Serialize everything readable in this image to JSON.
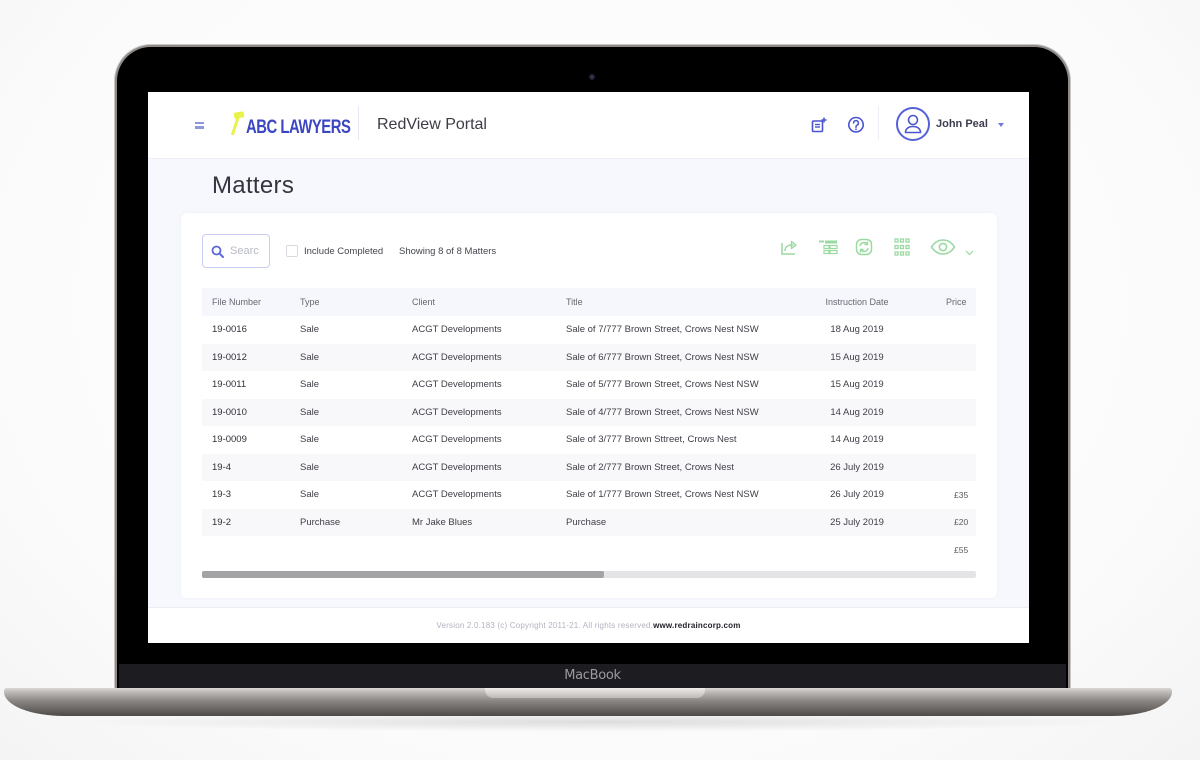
{
  "device": {
    "brand_label": "MacBook"
  },
  "header": {
    "menu_icon": "hamburger-icon",
    "logo_text": "ABC LAWYERS",
    "logo_icon": "gavel-icon",
    "portal_title": "RedView Portal",
    "icons": [
      "new-note-icon",
      "help-icon"
    ],
    "user": {
      "name": "John Peal",
      "avatar_icon": "user-avatar-icon",
      "caret_icon": "caret-down-icon"
    },
    "accent_color": "#4a55d0"
  },
  "page": {
    "title": "Matters"
  },
  "toolbar": {
    "search_placeholder": "Searc",
    "include_completed_label": "Include Completed",
    "include_completed_checked": false,
    "showing_text": "Showing 8 of 8 Matters",
    "tools": [
      "export-share-icon",
      "columns-layout-icon",
      "refresh-icon",
      "grid-view-icon",
      "eye-view-icon"
    ],
    "tool_color": "#9ad9a0"
  },
  "table": {
    "columns": [
      "File Number",
      "Type",
      "Client",
      "Title",
      "Instruction Date",
      "Price"
    ],
    "rows": [
      {
        "file_number": "19-0016",
        "type": "Sale",
        "client": "ACGT Developments",
        "title": "Sale of 7/777 Brown Street, Crows Nest NSW",
        "instruction_date": "18 Aug 2019",
        "price": ""
      },
      {
        "file_number": "19-0012",
        "type": "Sale",
        "client": "ACGT Developments",
        "title": "Sale of 6/777 Brown Street, Crows Nest NSW",
        "instruction_date": "15 Aug 2019",
        "price": ""
      },
      {
        "file_number": "19-0011",
        "type": "Sale",
        "client": "ACGT Developments",
        "title": "Sale of 5/777 Brown Street, Crows Nest NSW",
        "instruction_date": "15 Aug 2019",
        "price": ""
      },
      {
        "file_number": "19-0010",
        "type": "Sale",
        "client": "ACGT Developments",
        "title": "Sale of 4/777 Brown Street, Crows Nest NSW",
        "instruction_date": "14 Aug 2019",
        "price": ""
      },
      {
        "file_number": "19-0009",
        "type": "Sale",
        "client": "ACGT Developments",
        "title": "Sale of 3/777 Brown Sttreet, Crows Nest",
        "instruction_date": "14 Aug 2019",
        "price": ""
      },
      {
        "file_number": "19-4",
        "type": "Sale",
        "client": "ACGT Developments",
        "title": "Sale of 2/777 Brown Street, Crows Nest",
        "instruction_date": "26 July 2019",
        "price": ""
      },
      {
        "file_number": "19-3",
        "type": "Sale",
        "client": "ACGT Developments",
        "title": "Sale of 1/777 Brown Street, Crows Nest NSW",
        "instruction_date": "26 July 2019",
        "price": "£35"
      },
      {
        "file_number": "19-2",
        "type": "Purchase",
        "client": "Mr Jake Blues",
        "title": "Purchase",
        "instruction_date": "25 July 2019",
        "price": "£20"
      }
    ],
    "total_price": "£55",
    "horizontal_scroll_fraction_visible": 0.52
  },
  "footer": {
    "text": "Version 2.0.183 (c) Copyright 2011-21. All rights reserved.",
    "link_text": "www.redraincorp.com"
  }
}
